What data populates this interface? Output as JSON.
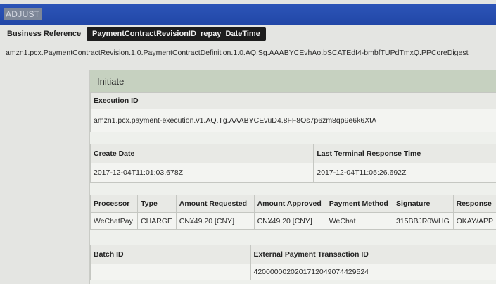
{
  "window": {
    "title": "ADJUST"
  },
  "business_reference": {
    "label": "Business Reference",
    "value": "PaymentContractRevisionID_repay_DateTime"
  },
  "revision_id": "amzn1.pcx.PaymentContractRevision.1.0.PaymentContractDefinition.1.0.AQ.Sg.AAABYCEvhAo.bSCATEdI4-bmbfTUPdTmxQ.PPCoreDigest",
  "section": {
    "title": "Initiate"
  },
  "execution": {
    "header": "Execution ID",
    "value": "amzn1.pcx.payment-execution.v1.AQ.Tg.AAABYCEvuD4.8FF8Os7p6zm8qp9e6k6XtA"
  },
  "dates": {
    "headers": [
      "Create Date",
      "Last Terminal Response Time"
    ],
    "values": [
      "2017-12-04T11:01:03.678Z",
      "2017-12-04T11:05:26.692Z"
    ]
  },
  "processing": {
    "headers": [
      "Processor",
      "Type",
      "Amount Requested",
      "Amount Approved",
      "Payment Method",
      "Signature",
      "Response"
    ],
    "row": [
      "WeChatPay",
      "CHARGE",
      "CN¥49.20 [CNY]",
      "CN¥49.20 [CNY]",
      "WeChat",
      "315BBJR0WHG",
      "OKAY/APP"
    ]
  },
  "batch": {
    "headers": [
      "Batch ID",
      "External Payment Transaction ID"
    ],
    "values": [
      "",
      "4200000020201712049074429524"
    ]
  }
}
